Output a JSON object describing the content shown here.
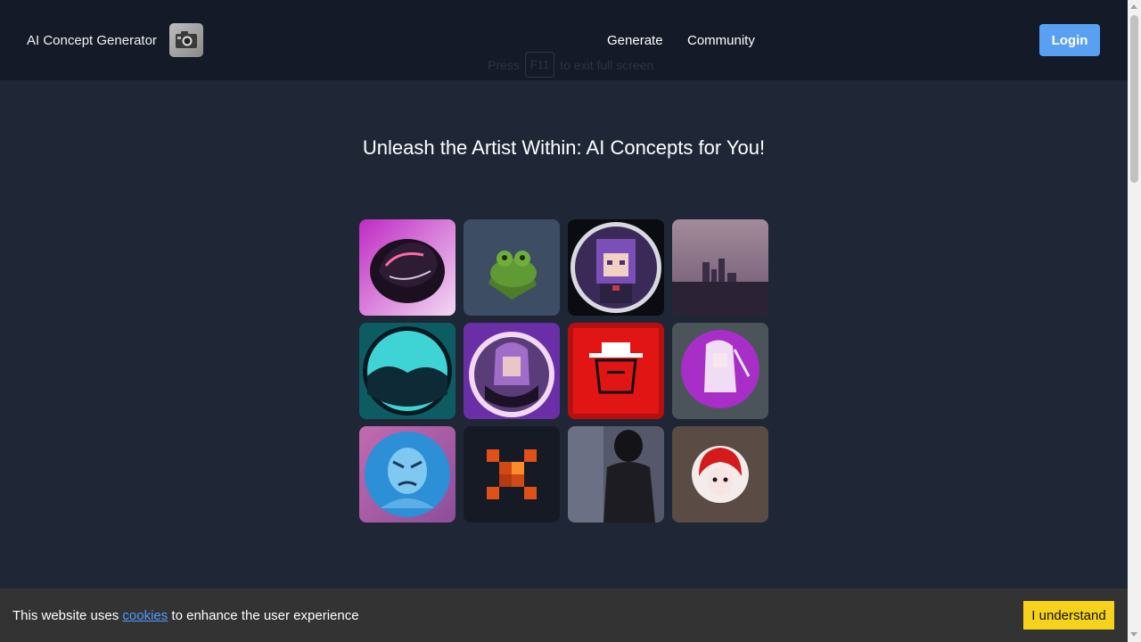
{
  "header": {
    "brand": "AI Concept Generator",
    "logo_icon": "camera-icon",
    "nav": [
      {
        "label": "Generate"
      },
      {
        "label": "Community"
      }
    ],
    "login_label": "Login",
    "fullscreen_hint": {
      "pre": "Press",
      "key": "F11",
      "post": "to exit full screen"
    }
  },
  "main": {
    "headline": "Unleash the Artist Within: AI Concepts for You!",
    "gallery": [
      {
        "icon": "purple-car-icon"
      },
      {
        "icon": "green-frog-icon"
      },
      {
        "icon": "pixel-anime-girl-icon"
      },
      {
        "icon": "city-skyline-icon"
      },
      {
        "icon": "teal-circle-landscape-icon"
      },
      {
        "icon": "anime-girl-purple-icon"
      },
      {
        "icon": "red-hat-figure-icon"
      },
      {
        "icon": "anime-girl-sword-icon"
      },
      {
        "icon": "blue-angry-face-icon"
      },
      {
        "icon": "pixel-orange-cross-icon"
      },
      {
        "icon": "dark-hair-woman-icon"
      },
      {
        "icon": "red-hair-face-icon"
      }
    ]
  },
  "cookie_bar": {
    "text_before": "This website uses",
    "link": "cookies",
    "text_after": "to enhance the user experience",
    "button": "I understand"
  },
  "colors": {
    "page_bg": "#1f2737",
    "header_bg": "#141a28",
    "login_bg": "#5aa0f2",
    "cookie_bar_bg": "#333333",
    "cookie_button_bg": "#f6d21a",
    "link": "#4d9cff"
  }
}
